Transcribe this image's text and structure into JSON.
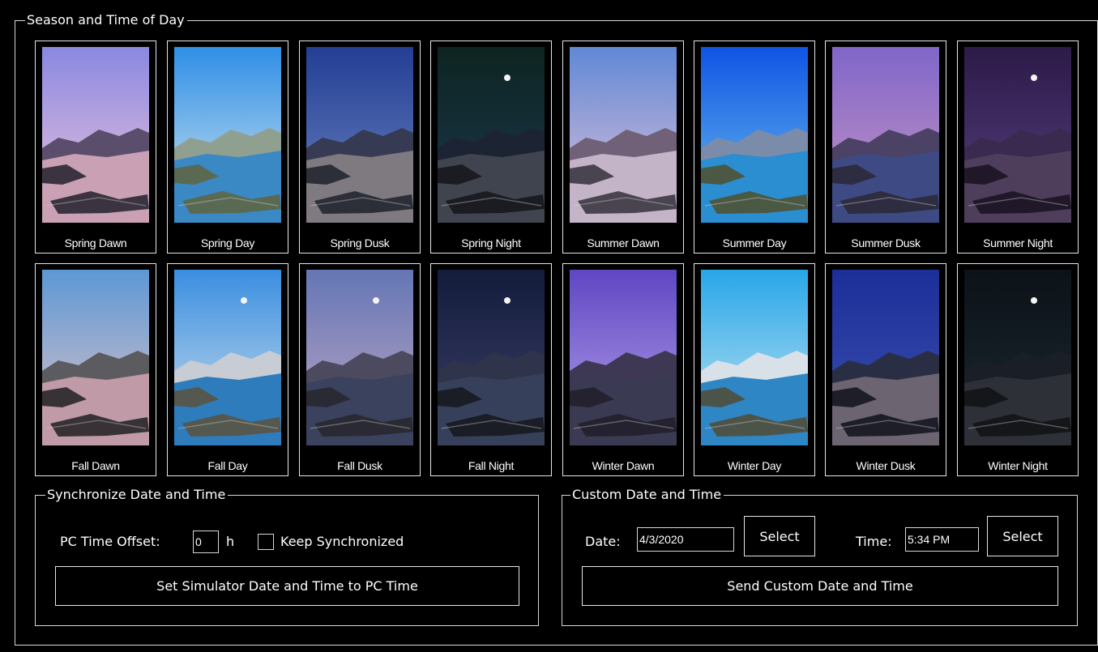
{
  "season_group": {
    "title": "Season and Time of Day",
    "presets": [
      {
        "label": "Spring Dawn",
        "sky_top": "#8a88e0",
        "sky_bottom": "#f0c6de",
        "mountain": "#5a4e6c",
        "water": "#c9a0b4",
        "land": "#3b3440"
      },
      {
        "label": "Spring Day",
        "sky_top": "#2f8ee6",
        "sky_bottom": "#d4e8ef",
        "mountain": "#90a090",
        "water": "#3a88c4",
        "land": "#5a6a52"
      },
      {
        "label": "Spring Dusk",
        "sky_top": "#233e94",
        "sky_bottom": "#6c84c0",
        "mountain": "#363a52",
        "water": "#7e7a80",
        "land": "#2c2e38"
      },
      {
        "label": "Spring Night",
        "sky_top": "#0d2420",
        "sky_bottom": "#1c3850",
        "mountain": "#1c2434",
        "water": "#40444e",
        "land": "#1a1c22",
        "moon": true
      },
      {
        "label": "Summer Dawn",
        "sky_top": "#6088d6",
        "sky_bottom": "#e4c4d8",
        "mountain": "#706078",
        "water": "#c4b4c8",
        "land": "#4a4450"
      },
      {
        "label": "Summer Day",
        "sky_top": "#1054e4",
        "sky_bottom": "#6cc0ec",
        "mountain": "#7a8caa",
        "water": "#2a8ed0",
        "land": "#4a5844"
      },
      {
        "label": "Summer Dusk",
        "sky_top": "#8066c8",
        "sky_bottom": "#c896c6",
        "mountain": "#4c4266",
        "water": "#3e4a84",
        "land": "#2e2c40"
      },
      {
        "label": "Summer Night",
        "sky_top": "#2c1a48",
        "sky_bottom": "#584080",
        "mountain": "#3a2a50",
        "water": "#4e3e5c",
        "land": "#201828",
        "moon": true
      },
      {
        "label": "Fall Dawn",
        "sky_top": "#5c98d4",
        "sky_bottom": "#e4c4c8",
        "mountain": "#5c5c60",
        "water": "#c09aa6",
        "land": "#383236"
      },
      {
        "label": "Fall Day",
        "sky_top": "#3a8ee0",
        "sky_bottom": "#d0e2ec",
        "mountain": "#c8ccd4",
        "water": "#2e7cbc",
        "land": "#54584e",
        "moon": true
      },
      {
        "label": "Fall Dusk",
        "sky_top": "#6476b4",
        "sky_bottom": "#c0a8c6",
        "mountain": "#4c4a5e",
        "water": "#3a425e",
        "land": "#2a2a34",
        "moon": true
      },
      {
        "label": "Fall Night",
        "sky_top": "#141c3c",
        "sky_bottom": "#3a4068",
        "mountain": "#30344a",
        "water": "#36405a",
        "land": "#1a1c26",
        "moon": true
      },
      {
        "label": "Winter Dawn",
        "sky_top": "#6046c4",
        "sky_bottom": "#b6a4e8",
        "mountain": "#3e3854",
        "water": "#3a3a52",
        "land": "#24222e"
      },
      {
        "label": "Winter Day",
        "sky_top": "#28a6e8",
        "sky_bottom": "#c8e8f2",
        "mountain": "#d8e0e8",
        "water": "#2e86c4",
        "land": "#4c544a"
      },
      {
        "label": "Winter Dusk",
        "sky_top": "#1c2e98",
        "sky_bottom": "#3c50b0",
        "mountain": "#2a2e44",
        "water": "#6c6470",
        "land": "#1e1e28"
      },
      {
        "label": "Winter Night",
        "sky_top": "#0c1218",
        "sky_bottom": "#1a2830",
        "mountain": "#1a1e26",
        "water": "#2e3038",
        "land": "#14161a",
        "moon": true
      }
    ]
  },
  "sync_group": {
    "title": "Synchronize Date and Time",
    "offset_label": "PC Time Offset:",
    "offset_value": "0",
    "offset_unit": "h",
    "keep_sync_label": "Keep Synchronized",
    "set_button": "Set Simulator Date and Time to PC Time"
  },
  "custom_group": {
    "title": "Custom Date and Time",
    "date_label": "Date:",
    "date_value": "4/3/2020",
    "date_select": "Select",
    "time_label": "Time:",
    "time_value": "5:34 PM",
    "time_select": "Select",
    "send_button": "Send Custom Date and Time"
  }
}
